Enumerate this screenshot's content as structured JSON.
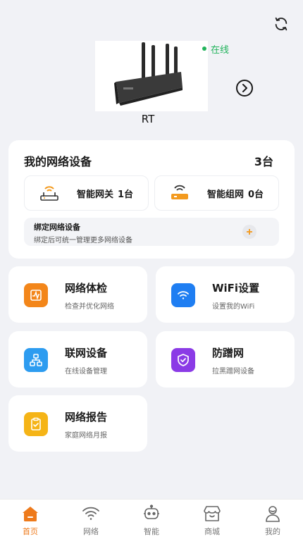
{
  "header": {
    "device_name": "RT",
    "status_text": "在线",
    "status_color": "#21b35b"
  },
  "devices": {
    "title": "我的网络设备",
    "count": "3台",
    "gateway": {
      "label": "智能网关",
      "count": "1台",
      "icon": "router-icon"
    },
    "mesh": {
      "label": "智能组网",
      "count": "0台",
      "icon": "mesh-router-icon"
    },
    "bind": {
      "title": "绑定网络设备",
      "subtitle": "绑定后可统一管理更多网络设备",
      "icon": "plus-icon"
    }
  },
  "features": [
    {
      "title": "网络体检",
      "subtitle": "检查并优化网络",
      "icon": "checkup-icon",
      "color": "#f3861a"
    },
    {
      "title": "WiFi设置",
      "subtitle": "设置我的WiFi",
      "icon": "wifi-icon",
      "color": "#1f7ef2"
    },
    {
      "title": "联网设备",
      "subtitle": "在线设备管理",
      "icon": "network-devices-icon",
      "color": "#2d9cf0"
    },
    {
      "title": "防蹭网",
      "subtitle": "拉黑蹭网设备",
      "icon": "shield-icon",
      "color": "#8b3be6"
    },
    {
      "title": "网络报告",
      "subtitle": "家庭网络月报",
      "icon": "report-icon",
      "color": "#f5b417"
    }
  ],
  "tabs": [
    {
      "label": "首页",
      "icon": "home-icon",
      "active": true
    },
    {
      "label": "网络",
      "icon": "wifi-icon",
      "active": false
    },
    {
      "label": "智能",
      "icon": "robot-icon",
      "active": false
    },
    {
      "label": "商城",
      "icon": "store-icon",
      "active": false
    },
    {
      "label": "我的",
      "icon": "person-icon",
      "active": false
    }
  ],
  "colors": {
    "accent": "#ee7a1b",
    "background": "#f1f2f6"
  }
}
